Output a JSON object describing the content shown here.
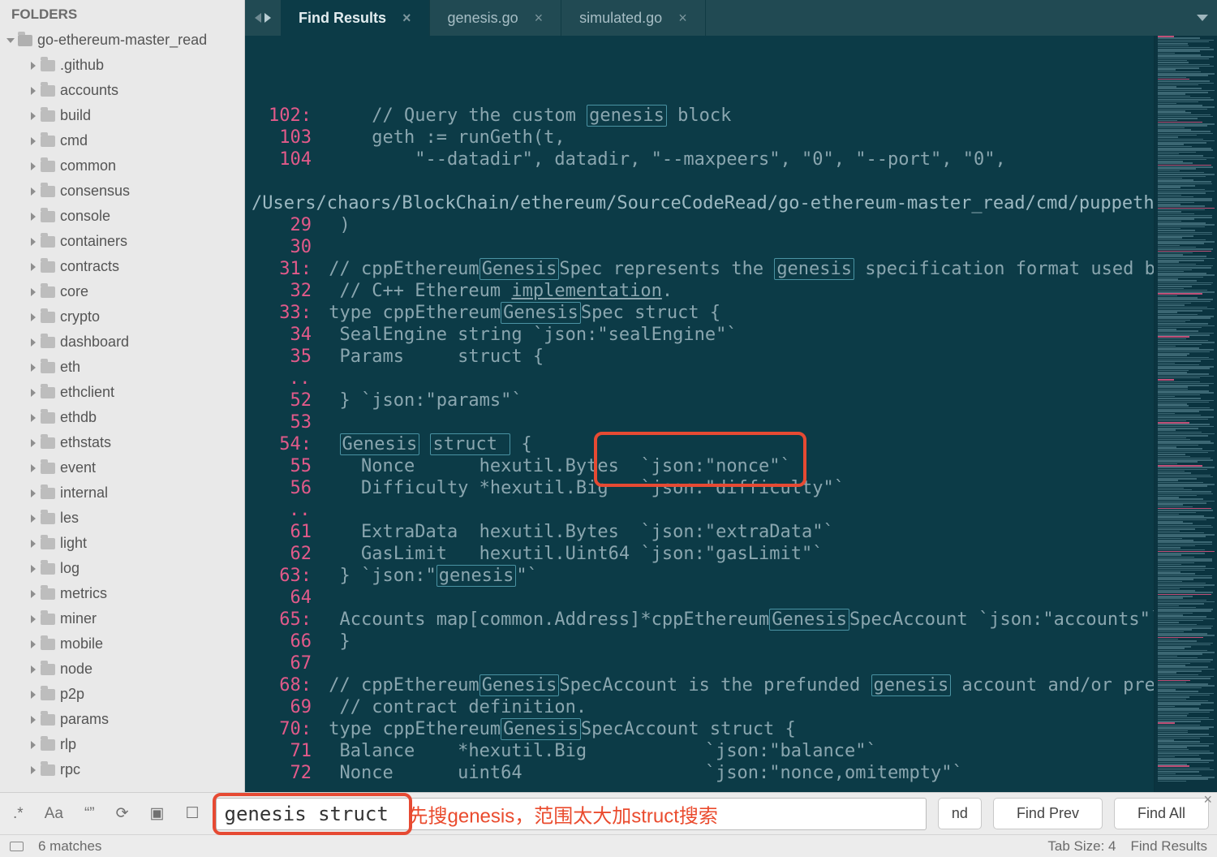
{
  "sidebar": {
    "header": "FOLDERS",
    "root": "go-ethereum-master_read",
    "folders": [
      ".github",
      "accounts",
      "build",
      "cmd",
      "common",
      "consensus",
      "console",
      "containers",
      "contracts",
      "core",
      "crypto",
      "dashboard",
      "eth",
      "ethclient",
      "ethdb",
      "ethstats",
      "event",
      "internal",
      "les",
      "light",
      "log",
      "metrics",
      "miner",
      "mobile",
      "node",
      "p2p",
      "params",
      "rlp",
      "rpc"
    ]
  },
  "tabs": [
    {
      "label": "Find Results",
      "active": true
    },
    {
      "label": "genesis.go",
      "active": false
    },
    {
      "label": "simulated.go",
      "active": false
    }
  ],
  "code": {
    "path": "/Users/chaors/BlockChain/ethereum/SourceCodeRead/go-ethereum-master_read/cmd/puppeth/genesis.go:",
    "lines": [
      {
        "n": "102",
        "colon": ":",
        "t": "     // Query the custom |genesis| block"
      },
      {
        "n": "103",
        "t": "     geth := runGeth(t,"
      },
      {
        "n": "104",
        "t": "         \"--datadir\", datadir, \"--maxpeers\", \"0\", \"--port\", \"0\","
      },
      {
        "path": true
      },
      {
        "n": "29",
        "t": "  )"
      },
      {
        "n": "30",
        "t": ""
      },
      {
        "n": "31",
        "colon": ":",
        "t": " // cppEthereum|Genesis|Spec represents the |genesis| specification format used by the"
      },
      {
        "n": "32",
        "t": "  // C++ Ethereum ~implementation~."
      },
      {
        "n": "33",
        "colon": ":",
        "t": " type cppEthereum|Genesis|Spec struct {"
      },
      {
        "n": "34",
        "t": "  SealEngine string `json:\"sealEngine\"`"
      },
      {
        "n": "35",
        "t": "  Params     struct {"
      },
      {
        "ellip": true
      },
      {
        "n": "52",
        "t": "  } `json:\"params\"`"
      },
      {
        "n": "53",
        "t": ""
      },
      {
        "n": "54",
        "colon": ":",
        "t": "  |Genesis| |struct | {"
      },
      {
        "n": "55",
        "t": "    Nonce      hexutil.Bytes  `json:\"nonce\"`"
      },
      {
        "n": "56",
        "t": "    Difficulty *hexutil.Big   `json:\"difficulty\"`"
      },
      {
        "ellip": true
      },
      {
        "n": "61",
        "t": "    ExtraData  hexutil.Bytes  `json:\"extraData\"`"
      },
      {
        "n": "62",
        "t": "    GasLimit   hexutil.Uint64 `json:\"gasLimit\"`"
      },
      {
        "n": "63",
        "colon": ":",
        "t": "  } `json:\"|genesis|\"`"
      },
      {
        "n": "64",
        "t": ""
      },
      {
        "n": "65",
        "colon": ":",
        "t": "  Accounts map[common.Address]*cppEthereum|Genesis|SpecAccount `json:\"accounts\"`"
      },
      {
        "n": "66",
        "t": "  }"
      },
      {
        "n": "67",
        "t": ""
      },
      {
        "n": "68",
        "colon": ":",
        "t": " // cppEthereum|Genesis|SpecAccount is the prefunded |genesis| account and/or precompiled"
      },
      {
        "n": "69",
        "t": "  // contract definition."
      },
      {
        "n": "70",
        "colon": ":",
        "t": " type cppEthereum|Genesis|SpecAccount struct {"
      },
      {
        "n": "71",
        "t": "  Balance    *hexutil.Big           `json:\"balance\"`"
      },
      {
        "n": "72",
        "t": "  Nonce      uint64                 `json:\"nonce,omitempty\"`"
      }
    ]
  },
  "find": {
    "toggles": {
      "regex": ".*",
      "case": "Aa",
      "whole": "“”",
      "wrap": "⟳",
      "sel": "▣",
      "hl": "☐"
    },
    "value": "genesis struct",
    "overlay": "先搜genesis，范围太大加struct搜索",
    "find_btn": "nd",
    "prev": "Find Prev",
    "all": "Find All"
  },
  "status": {
    "matches": "6 matches",
    "tabsize": "Tab Size: 4",
    "syntax": "Find Results"
  }
}
